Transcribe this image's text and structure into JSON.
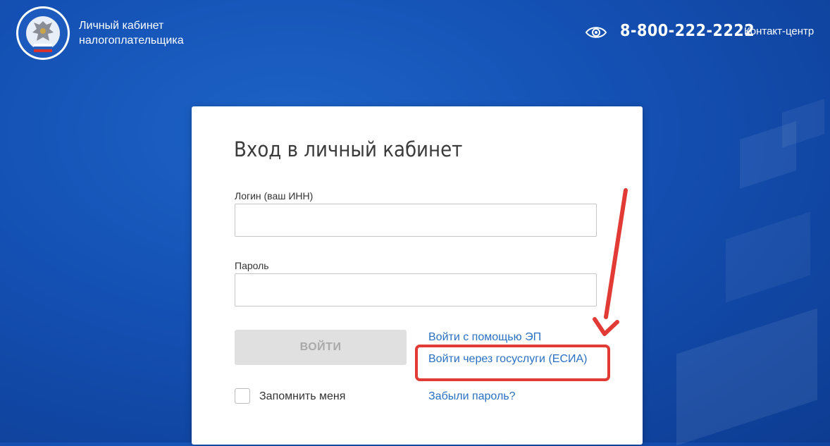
{
  "header": {
    "brand_line1": "Личный кабинет",
    "brand_line2": "налогоплательщика",
    "logo_icon": "fns-emblem-icon",
    "eye_icon": "eye-icon",
    "phone": "8-800-222-2222",
    "contact_center": "Контакт-центр"
  },
  "login": {
    "title": "Вход в личный кабинет",
    "login_label": "Логин (ваш ИНН)",
    "login_value": "",
    "password_label": "Пароль",
    "password_value": "",
    "submit_label": "ВОЙТИ",
    "remember_label": "Запомнить меня",
    "remember_checked": false,
    "links": {
      "ep": "Войти с помощью ЭП",
      "esia": "Войти через госуслуги (ЕСИА)",
      "forgot": "Забыли пароль?"
    }
  },
  "colors": {
    "background": "#1450b3",
    "link": "#2a70c2",
    "annotation": "#e23b36",
    "button_disabled": "#e0e0e0"
  }
}
